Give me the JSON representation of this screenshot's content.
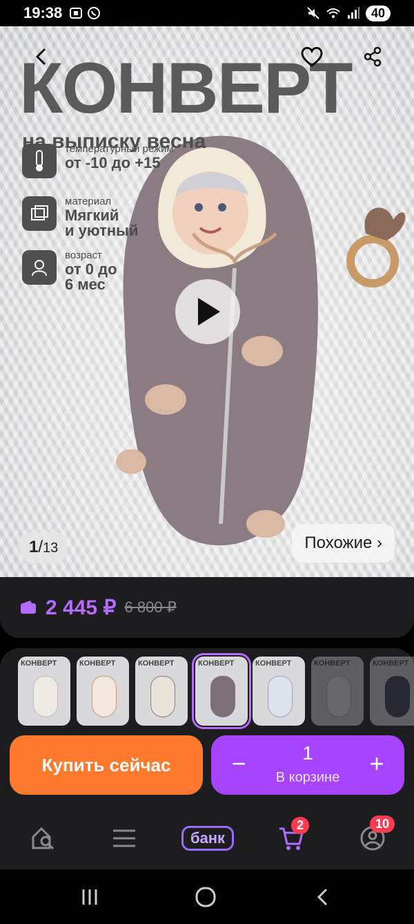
{
  "status_bar": {
    "time": "19:38",
    "battery": "40",
    "icons": [
      "screenshot-icon",
      "whatsapp-icon",
      "mute-icon",
      "wifi-icon",
      "signal-icon"
    ]
  },
  "hero": {
    "title": "КОНВЕРТ",
    "subtitle": "на выписку весна",
    "features": [
      {
        "label": "температурный режим",
        "value": "от -10 до +15",
        "icon": "thermometer-icon"
      },
      {
        "label": "материал",
        "value_line1": "Мягкий",
        "value_line2": "и уютный",
        "icon": "fabric-icon"
      },
      {
        "label": "возраст",
        "value_line1": "от 0 до",
        "value_line2": "6 мес",
        "icon": "baby-icon"
      }
    ],
    "counter_current": "1",
    "counter_sep": "/",
    "counter_total": "13",
    "similar_label": "Похожие ›"
  },
  "price": {
    "current": "2 445 ₽",
    "old": "6 800 ₽",
    "accent": "#b46cff"
  },
  "thumbnails": {
    "label": "КОНВЕРТ",
    "count": 7,
    "selected_index": 3
  },
  "actions": {
    "buy_label": "Купить сейчас",
    "minus": "−",
    "plus": "+",
    "quantity": "1",
    "in_cart_label": "В корзине",
    "buy_color": "#ff7a2d",
    "cart_color": "#a844ff"
  },
  "bottom_nav": {
    "bank_label": "банк",
    "cart_badge": "2",
    "profile_badge": "10"
  }
}
